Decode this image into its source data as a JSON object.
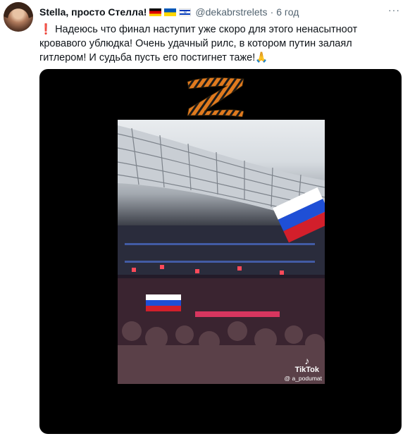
{
  "tweet": {
    "author_name": "Stella, просто Стелла!",
    "handle": "@dekabrstrelets",
    "separator": "·",
    "time": "6 год",
    "more_label": "···",
    "text_lines": [
      "Надеюсь что финал  наступит уже скоро для этого ненасытноот",
      "кровавого ублюдка! Очень удачный рилс, в котором  путин залаял",
      "гитлером! И судьба пусть его постигнет таже!🙏"
    ],
    "alert_glyph": "❗"
  },
  "media": {
    "watermark_brand": "TikTok",
    "watermark_user": "@ a_podumat",
    "tiktok_note": "♪"
  },
  "icons": {
    "flags": [
      "germany-flag-icon",
      "ukraine-flag-icon",
      "israel-flag-icon"
    ],
    "israel_star": "✡"
  },
  "colors": {
    "flag_white": "#ffffff",
    "flag_blue": "#1f4fd6",
    "flag_red": "#d21f2b",
    "ribbon_orange": "#e07a1e",
    "ribbon_black": "#1a1a1a"
  }
}
